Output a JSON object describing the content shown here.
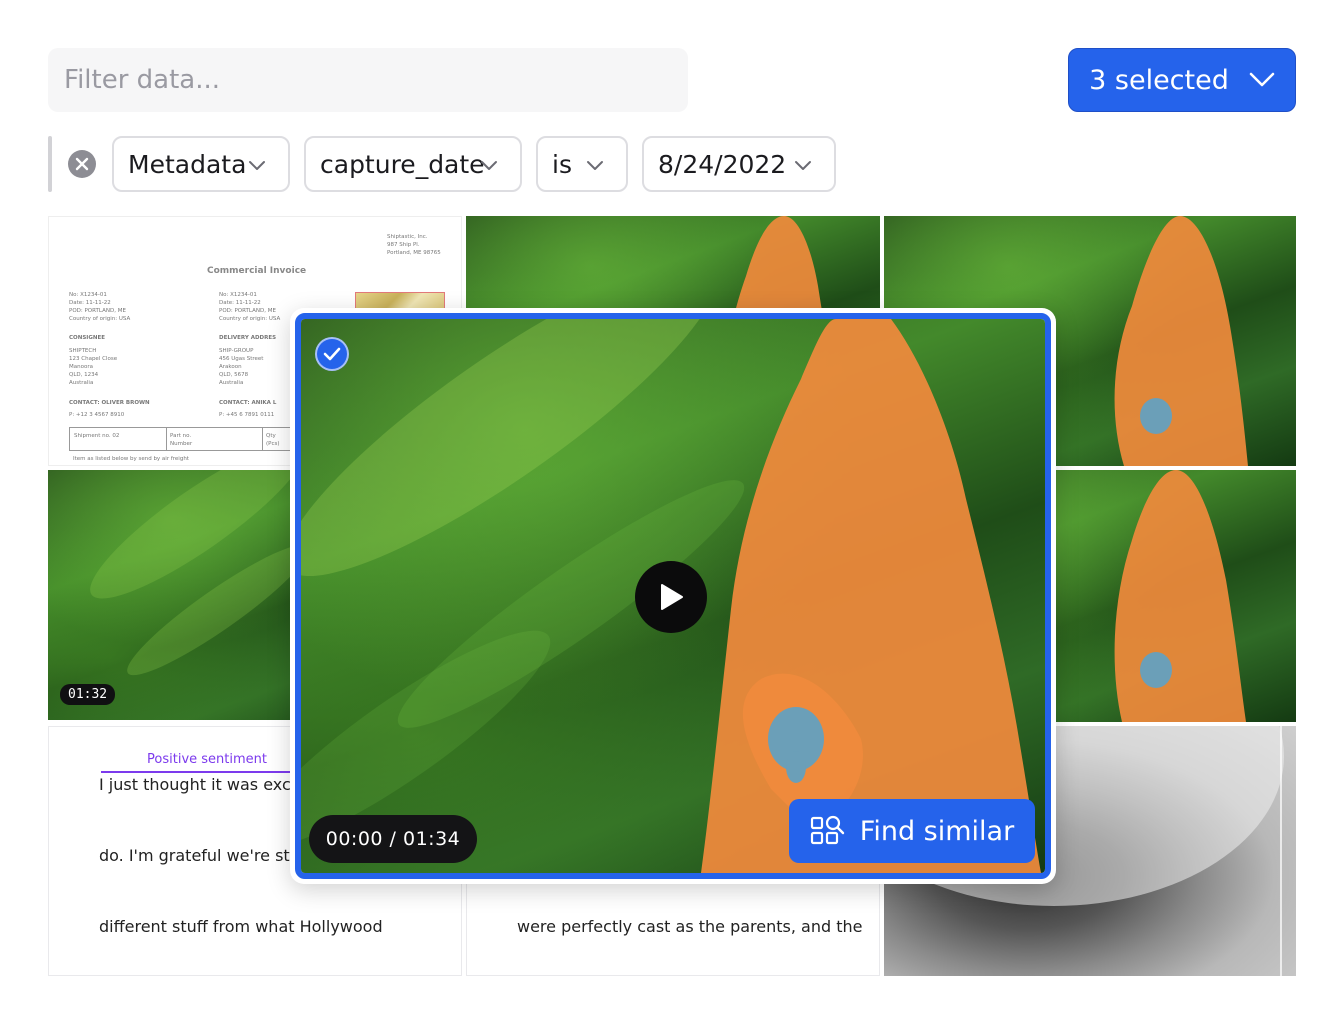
{
  "filter": {
    "placeholder": "Filter data..."
  },
  "selection": {
    "label": "3 selected"
  },
  "filter_rule": {
    "field_type": "Metadata",
    "field": "capture_date",
    "operator": "is",
    "value": "8/24/2022"
  },
  "invoice": {
    "sender": [
      "Shiptastic, Inc.",
      "987 Ship Pl.",
      "Portland, ME 98765"
    ],
    "title": "Commercial Invoice",
    "left_info": [
      "No: X1234-01",
      "Date: 11-11-22",
      "POD: PORTLAND, ME",
      "Country of origin: USA"
    ],
    "right_info": [
      "No: X1234-01",
      "Date: 11-11-22",
      "POD: PORTLAND, ME",
      "Country of origin: USA"
    ],
    "consignee_heading": "CONSIGNEE",
    "consignee_lines": [
      "SHIPTECH",
      "123 Chapel Close",
      "Manoora",
      "QLD, 1234",
      "Australia"
    ],
    "delivery_heading": "DELIVERY ADDRES",
    "delivery_lines": [
      "SHIP-GROUP",
      "456 Ugas Street",
      "Arakoon",
      "QLD, 5678",
      "Australia"
    ],
    "contact_left": "CONTACT: OLIVER BROWN",
    "phone_left": "P: +12 3 4567 8910",
    "contact_right": "CONTACT: ANIKA L",
    "phone_right": "P: +45 6 7891 0111",
    "table_headers": [
      "Shipment no. 02",
      "Part no. Number",
      "Qty (Pcs)"
    ],
    "table_note": "Item as listed below by send by air freight"
  },
  "video_tile_duration": "01:32",
  "text_tile_left": {
    "sentiment": "Positive sentiment",
    "lines": [
      "I just thought it was excell",
      "do. I'm grateful we're still",
      "different stuff from what Hollywood"
    ]
  },
  "text_tile_mid": {
    "lines": [
      "were perfectly cast as the parents, and the"
    ]
  },
  "player": {
    "time": "00:00 / 01:34",
    "find_similar": "Find similar"
  },
  "colors": {
    "accent": "#2563eb",
    "sentiment": "#7c3aed",
    "flower": "#f08a3c",
    "mask_blue": "#6b9fb8"
  },
  "icons": [
    "chevron-down-icon",
    "close-icon",
    "checkmark-icon",
    "play-icon",
    "find-similar-icon"
  ]
}
